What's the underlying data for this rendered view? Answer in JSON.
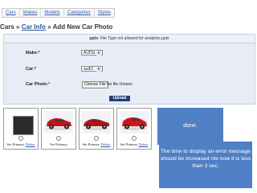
{
  "nav": {
    "items": [
      "Cars",
      "Makes",
      "Models",
      "Categories",
      "Styles"
    ]
  },
  "breadcrumb": {
    "root": "Cars",
    "separator": "»",
    "link": "Car Info",
    "current": "Add New Car Photo"
  },
  "error": {
    "filename": "pptx",
    "message": ": File Type not allowed for analytics.pptx"
  },
  "form": {
    "make": {
      "label": "Make:",
      "req": "*",
      "value": "AUDIs"
    },
    "car": {
      "label": "Car:",
      "req": "*",
      "value": "audi1"
    },
    "photo": {
      "label": "Car Photo:",
      "req": "*",
      "button": "Choose File",
      "status": "No file chosen"
    },
    "upload": "Upload"
  },
  "thumbnails": [
    {
      "primary_label": "Set Primary",
      "delete_label": "Delete"
    },
    {
      "primary_label": "Set Primary",
      "delete_label": "Delete"
    },
    {
      "primary_label": "Set Primary",
      "delete_label": "Delete"
    },
    {
      "primary_label": "Set Primary",
      "delete_label": "Delete"
    }
  ],
  "notes": {
    "done": "done.",
    "time": "The time to display an error message should be increased rite now it is less than 3 sec."
  },
  "colors": {
    "note_bg": "#4f7fc4",
    "car_red": "#c4141c",
    "button_navy": "#1f3f73"
  }
}
